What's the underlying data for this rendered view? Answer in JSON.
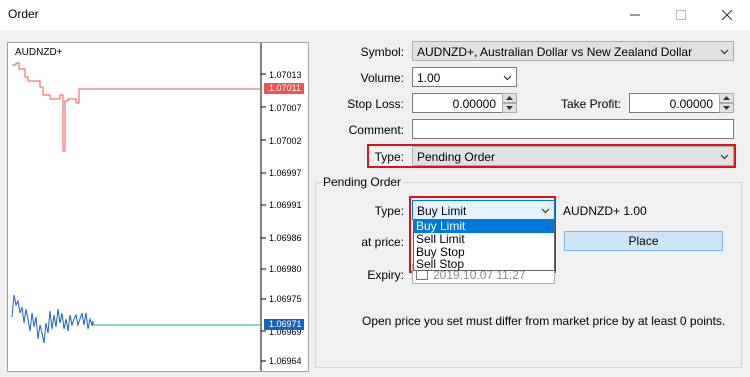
{
  "window": {
    "title": "Order"
  },
  "chart": {
    "symbol": "AUDNZD+",
    "price_ticks": [
      "1.07013",
      "1.07007",
      "1.07002",
      "1.06997",
      "1.06991",
      "1.06986",
      "1.06980",
      "1.06975",
      "1.06969",
      "1.06964"
    ],
    "ask_label": "1.07011",
    "bid_label": "1.06971",
    "colors": {
      "ask": "#ef5350",
      "bid": "#1565c0",
      "bid_line": "#26a69a"
    }
  },
  "form": {
    "symbol_label": "Symbol:",
    "symbol_value": "AUDNZD+, Australian Dollar vs New Zealand Dollar",
    "volume_label": "Volume:",
    "volume_value": "1.00",
    "stop_loss_label": "Stop Loss:",
    "stop_loss_value": "0.00000",
    "take_profit_label": "Take Profit:",
    "take_profit_value": "0.00000",
    "comment_label": "Comment:",
    "comment_value": "",
    "type_label": "Type:",
    "type_value": "Pending Order"
  },
  "pending": {
    "group_label": "Pending Order",
    "type_label": "Type:",
    "type_value": "Buy Limit",
    "options": [
      "Buy Limit",
      "Sell Limit",
      "Buy Stop",
      "Sell Stop"
    ],
    "symbol_volume": "AUDNZD+ 1.00",
    "at_price_label": "at price:",
    "place_button": "Place",
    "expiry_label": "Expiry:",
    "expiry_value": "2019.10.07 11:27",
    "note": "Open price you set must differ from market price by at least 0 points."
  },
  "highlight_color": "#e0101a"
}
